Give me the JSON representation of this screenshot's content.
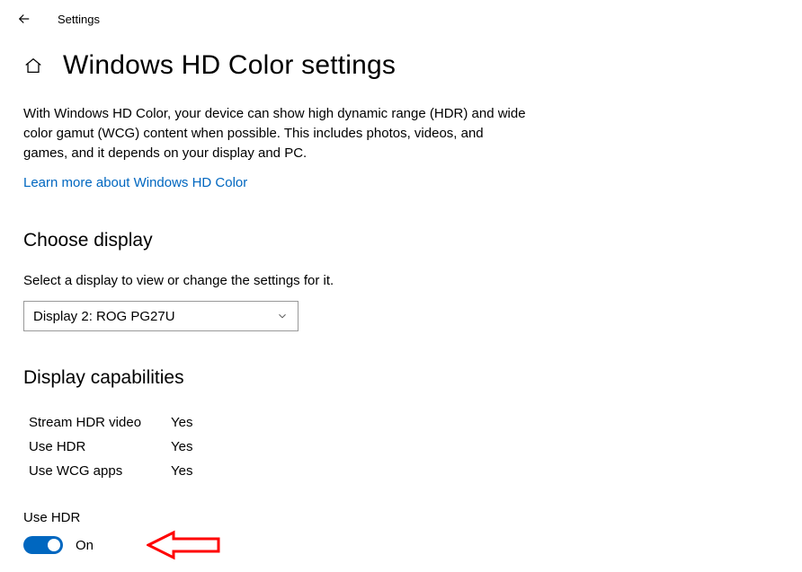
{
  "header": {
    "app_title": "Settings"
  },
  "page": {
    "title": "Windows HD Color settings",
    "description": "With Windows HD Color, your device can show high dynamic range (HDR) and wide color gamut (WCG) content when possible. This includes photos, videos, and games, and it depends on your display and PC.",
    "learn_more": "Learn more about Windows HD Color"
  },
  "choose_display": {
    "heading": "Choose display",
    "subtext": "Select a display to view or change the settings for it.",
    "selected": "Display 2: ROG PG27U"
  },
  "capabilities": {
    "heading": "Display capabilities",
    "rows": [
      {
        "label": "Stream HDR video",
        "value": "Yes"
      },
      {
        "label": "Use HDR",
        "value": "Yes"
      },
      {
        "label": "Use WCG apps",
        "value": "Yes"
      }
    ]
  },
  "use_hdr": {
    "label": "Use HDR",
    "state": "On"
  },
  "colors": {
    "link": "#0067c0",
    "toggle_on": "#0067c0",
    "annotation": "#ff0000"
  }
}
